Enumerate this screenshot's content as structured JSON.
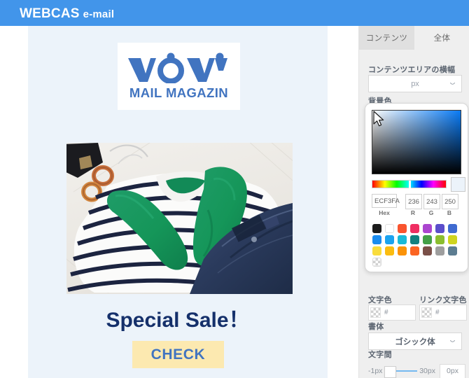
{
  "header": {
    "brand_primary": "WEBCAS",
    "brand_secondary": "e-mail",
    "bar_color": "#4295ea"
  },
  "canvas": {
    "background_color": "#ECF3FA",
    "logo_block": {
      "wordmark": "WOW",
      "subtitle": "MAIL MAGAZIN",
      "color": "#4174c0",
      "card_background": "#FFFFFF"
    },
    "photo": {
      "alt": "flat-lay of striped shirt with green sleeves, denim jeans, hoop earrings and black bag"
    },
    "headline": "Special Sale！",
    "headline_color": "#15306B",
    "cta": {
      "label": "CHECK",
      "background": "#FCE9B0",
      "text_color": "#4174C0"
    }
  },
  "panel": {
    "tabs": [
      {
        "label": "コンテンツ",
        "active": true
      },
      {
        "label": "全体",
        "active": false
      }
    ],
    "content_width": {
      "label": "コンテンツエリアの横幅",
      "value": "",
      "placeholder": "px",
      "unit": "px"
    },
    "background_color": {
      "label": "背景色"
    },
    "text_color": {
      "label": "文字色",
      "value": "",
      "placeholder": "#"
    },
    "link_color": {
      "label": "リンク文字色",
      "value": "",
      "placeholder": "#"
    },
    "font": {
      "label": "書体",
      "value": "ゴシック体"
    },
    "kerning": {
      "label": "文字間",
      "min_label": "-1px",
      "max_label": "30px",
      "value": "0px",
      "thumb_percent": 0
    }
  },
  "color_picker": {
    "hex_label": "Hex",
    "hex_value": "ECF3FA",
    "r_label": "R",
    "r_value": "236",
    "g_label": "G",
    "g_value": "243",
    "b_label": "B",
    "b_value": "250",
    "preview_color": "#ECF3FA",
    "swatch_rows": [
      [
        "#1c1c1c",
        "#ffffff",
        "#f9542e",
        "#ef2e62",
        "#ab45cf",
        "#5b4ecb",
        "#3f6ad0"
      ],
      [
        "#1a8cf0",
        "#1ba3ef",
        "#19bad8",
        "#12807f",
        "#43a047",
        "#8bbe2f",
        "#cfd41f"
      ],
      [
        "#f9dc3c",
        "#fbbc10",
        "#fb9308",
        "#fb6422",
        "#7a5048",
        "#9e9e9e",
        "#5c7d91"
      ]
    ],
    "transparent_swatch": "transparent"
  }
}
